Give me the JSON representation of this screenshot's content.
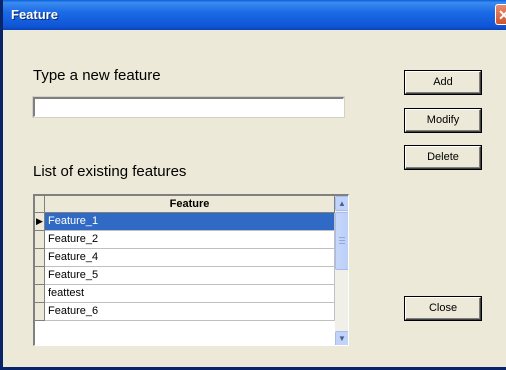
{
  "window": {
    "title": "Feature",
    "close_symbol": "✕"
  },
  "form": {
    "new_feature_label": "Type a new feature",
    "new_feature_value": "",
    "list_label": "List of existing features"
  },
  "buttons": {
    "add": "Add",
    "modify": "Modify",
    "delete": "Delete",
    "close": "Close"
  },
  "grid": {
    "column_header": "Feature",
    "selected_row_marker": "▶",
    "rows": [
      "Feature_1",
      "Feature_2",
      "Feature_4",
      "Feature_5",
      "feattest",
      "Feature_6"
    ],
    "selected_index": 0
  },
  "scrollbar": {
    "up_arrow": "▲",
    "down_arrow": "▼"
  },
  "colors": {
    "titlebar": "#0F55D6",
    "dialog_background": "#ECE9D8",
    "selection": "#316AC5"
  }
}
